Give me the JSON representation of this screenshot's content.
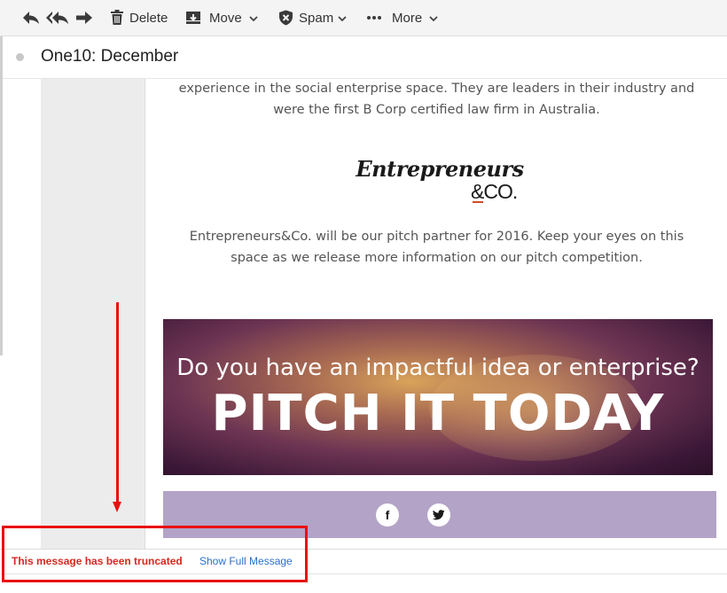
{
  "toolbar": {
    "reply_icon": "reply-icon",
    "reply_all_icon": "reply-all-icon",
    "forward_icon": "forward-icon",
    "delete_label": "Delete",
    "move_label": "Move",
    "spam_label": "Spam",
    "more_label": "More"
  },
  "message": {
    "subject": "One10: December",
    "para1_line1": "experience in the social enterprise space. They are leaders in their industry and",
    "para1_line2": "were the first B Corp certified law firm in Australia.",
    "logo_line1": "Entrepreneurs",
    "logo_line2": "&CO.",
    "para2_line1": "Entrepreneurs&Co. will be our pitch partner for 2016. Keep your eyes on this",
    "para2_line2": "space as we release more information on our pitch competition.",
    "banner_line1": "Do you have an impactful idea or enterprise?",
    "banner_line2": "PITCH IT TODAY",
    "facebook_glyph": "f",
    "twitter_icon": "twitter-icon"
  },
  "truncation": {
    "notice": "This message has been truncated",
    "link": "Show Full Message"
  },
  "colors": {
    "annotation_red": "#e8100c",
    "link_blue": "#2a6fc9",
    "social_bar": "#b3a3c6"
  }
}
